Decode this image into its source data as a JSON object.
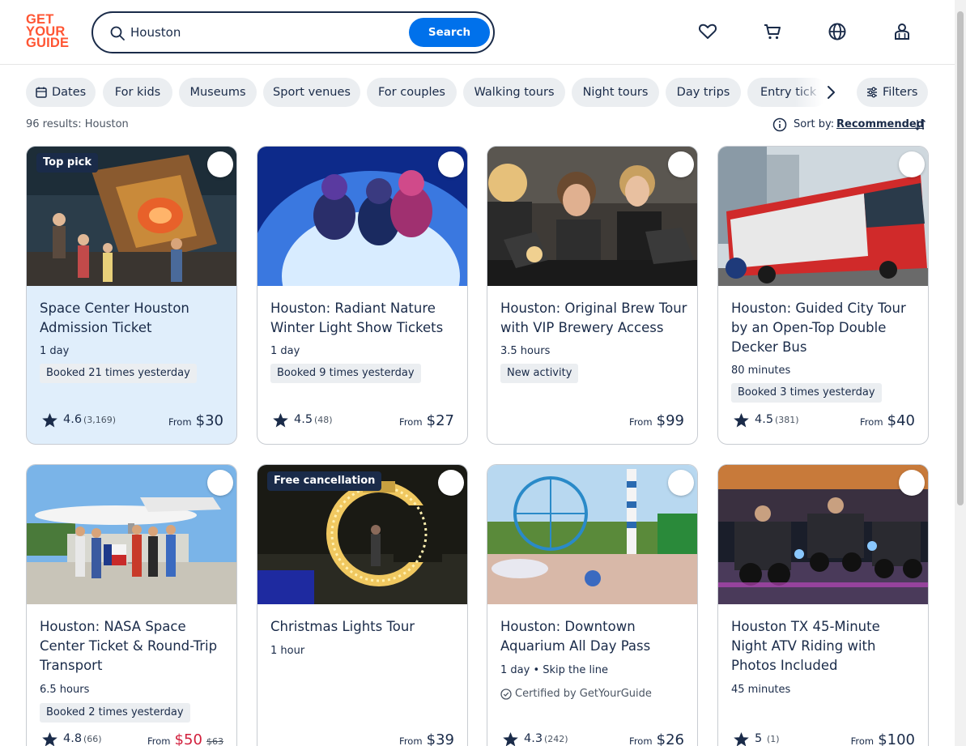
{
  "logo": {
    "line1": "GET",
    "line2": "YOUR",
    "line3": "GUIDE",
    "color": "#ff5533"
  },
  "search": {
    "value": "Houston",
    "button_label": "Search",
    "accent": "#0071eb"
  },
  "header_icons": [
    "heart-icon",
    "cart-icon",
    "globe-icon",
    "profile-icon"
  ],
  "filters": {
    "chips": [
      "Dates",
      "For kids",
      "Museums",
      "Sport venues",
      "For couples",
      "Walking tours",
      "Night tours",
      "Day trips",
      "Entry tick"
    ],
    "filters_label": "Filters"
  },
  "results": {
    "count_text": "96 results: Houston"
  },
  "sort": {
    "label": "Sort by:",
    "value": "Recommended"
  },
  "cards": [
    {
      "title": "Space Center Houston Admission Ticket",
      "badge": "Top pick",
      "duration": "1 day",
      "tag": "Booked 21 times yesterday",
      "rating": "4.6",
      "reviews": "(3,169)",
      "from": "From",
      "price": "$30"
    },
    {
      "title": "Houston: Radiant Nature Winter Light Show Tickets",
      "duration": "1 day",
      "tag": "Booked 9 times yesterday",
      "rating": "4.5",
      "reviews": "(48)",
      "from": "From",
      "price": "$27"
    },
    {
      "title": "Houston: Original Brew Tour with VIP Brewery Access",
      "duration": "3.5 hours",
      "tag": "New activity",
      "from": "From",
      "price": "$99"
    },
    {
      "title": "Houston: Guided City Tour by an Open-Top Double Decker Bus",
      "duration": "80 minutes",
      "tag": "Booked 3 times yesterday",
      "rating": "4.5",
      "reviews": "(381)",
      "from": "From",
      "price": "$40"
    },
    {
      "title": "Houston: NASA Space Center Ticket & Round-Trip Transport",
      "duration": "6.5 hours",
      "tag": "Booked 2 times yesterday",
      "rating": "4.8",
      "reviews": "(66)",
      "from": "From",
      "price": "$50",
      "original_price": "$63"
    },
    {
      "title": "Christmas Lights Tour",
      "badge": "Free cancellation",
      "duration": "1 hour",
      "from": "From",
      "price": "$39"
    },
    {
      "title": "Houston: Downtown Aquarium All Day Pass",
      "duration": "1 day • Skip the line",
      "certified": "Certified by GetYourGuide",
      "rating": "4.3",
      "reviews": "(242)",
      "from": "From",
      "price": "$26"
    },
    {
      "title": "Houston TX 45-Minute Night ATV Riding with Photos Included",
      "duration": "45 minutes",
      "rating": "5",
      "reviews": "(1)",
      "from": "From",
      "price": "$100"
    }
  ]
}
